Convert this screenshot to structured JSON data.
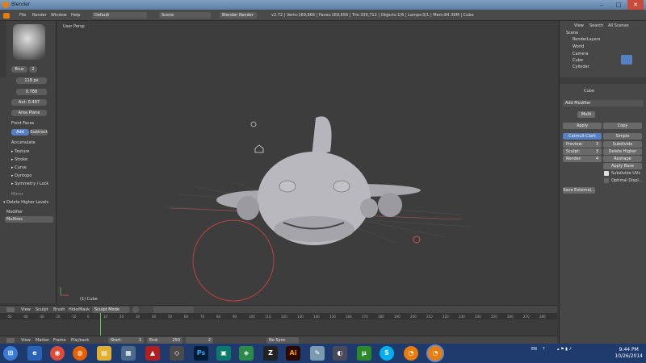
{
  "window": {
    "title": "Blender"
  },
  "topbar": {
    "menus": [
      "File",
      "Render",
      "Window",
      "Help"
    ],
    "layout": "Default",
    "scene": "Scene",
    "engine": "Blender Render",
    "stats": "v2.72 | Verts:169,866 | Faces:169,656 | Tris:339,712 | Objects:1/6 | Lamps:0/1 | Mem:84.39M | Cube"
  },
  "left_panel": {
    "brush_name": "Brus",
    "brush_users": "2",
    "radius": "118 px",
    "strength": "0.788",
    "autosmooth": "Aut: 0.497",
    "area_plane": "Area Plane",
    "front_faces": "Front Faces",
    "add_label": "Add",
    "subtract_label": "Subtract",
    "accumulate": "Accumulate",
    "sections": [
      "Texture",
      "Stroke",
      "Curve",
      "Dyntopo",
      "Symmetry / Lock"
    ],
    "options_label": "Mirror",
    "delete_higher": "Delete Higher Levels",
    "modifier_label": "Modifier",
    "modifier_value": "Multires"
  },
  "viewport": {
    "label": "User Persp",
    "object_label": "(1) Cube"
  },
  "viewport_toolbar": {
    "items": [
      "View",
      "Sculpt",
      "Brush",
      "Hide/Mask"
    ],
    "mode": "Sculpt Mode"
  },
  "timeline": {
    "ticks": [
      "-50",
      "-40",
      "-30",
      "-20",
      "-10",
      "0",
      "10",
      "20",
      "30",
      "40",
      "50",
      "60",
      "70",
      "80",
      "90",
      "100",
      "110",
      "120",
      "130",
      "140",
      "150",
      "160",
      "170",
      "180",
      "190",
      "200",
      "210",
      "220",
      "230",
      "240",
      "250",
      "260",
      "270",
      "280"
    ],
    "menus": [
      "View",
      "Marker",
      "Frame",
      "Playback"
    ],
    "start": "Start:",
    "start_val": "1",
    "end": "End:",
    "end_val": "250",
    "current": "2",
    "sync": "No Sync"
  },
  "right_panel": {
    "outliner_tabs": [
      "View",
      "Search",
      "All Scenes"
    ],
    "outliner_items": [
      "Scene",
      "RenderLayers",
      "World",
      "Camera",
      "Cube",
      "Cylinder"
    ],
    "object_name": "Cube",
    "add_modifier": "Add Modifier",
    "modifier_name": "Multi",
    "apply": "Apply",
    "copy": "Copy",
    "catmull": "Catmull-Clark",
    "simple": "Simple",
    "preview": "Preview:",
    "preview_val": "3",
    "sculpt": "Sculpt:",
    "sculpt_val": "3",
    "render": "Render:",
    "render_val": "4",
    "subdivide": "Subdivide",
    "delete_higher": "Delete Higher",
    "reshape": "Reshape",
    "apply_base": "Apply Base",
    "subdivide_uvs": "Subdivide UVs",
    "optimal_display": "Optimal Displ...",
    "save_external": "Save External..."
  },
  "taskbar": {
    "lang": "EN",
    "time": "9:44 PM",
    "date": "10/26/2014",
    "app_labels": [
      "Ps",
      "Ai",
      "S"
    ]
  },
  "colors": {
    "accent_blue": "#5680c2",
    "blender_orange": "#e87d0d",
    "taskbar": "#1f3b6e"
  }
}
